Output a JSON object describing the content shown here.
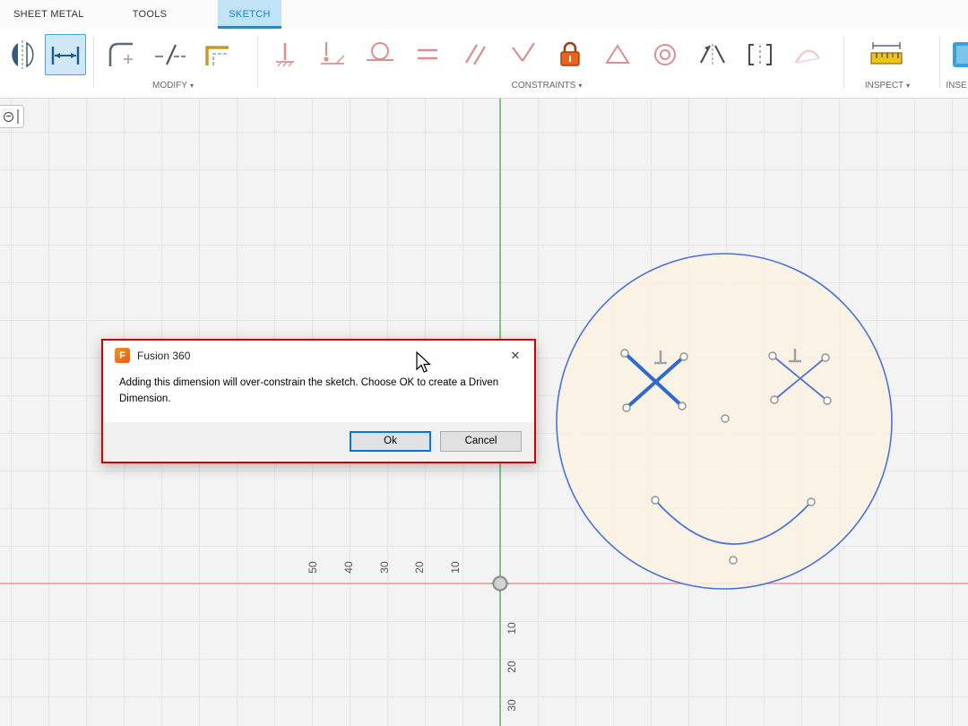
{
  "tabs": {
    "sheet_metal": "SHEET METAL",
    "tools": "TOOLS",
    "sketch": "SKETCH"
  },
  "toolbar": {
    "modify_label": "MODIFY",
    "constraints_label": "CONSTRAINTS",
    "inspect_label": "INSPECT",
    "insert_label": "INSE",
    "caret": "▾",
    "left_tools": [
      "mirror-tool",
      "sketch-dimension-tool"
    ],
    "selected_tool": "sketch-dimension-tool",
    "modify_tools": [
      "fillet-tool",
      "trim-tool",
      "offset-tool"
    ],
    "constraint_tools": [
      "horizontal-vertical",
      "coincident",
      "tangent",
      "equal",
      "parallel",
      "perpendicular",
      "fix-lock",
      "midpoint",
      "concentric",
      "symmetry",
      "collinear",
      "curvature"
    ],
    "inspect_tools": [
      "measure"
    ]
  },
  "dialog": {
    "title": "Fusion 360",
    "logo_letter": "F",
    "close": "✕",
    "message": "Adding this dimension will over-constrain the sketch. Choose OK to create a Driven Dimension.",
    "ok": "Ok",
    "cancel": "Cancel"
  },
  "rulers": {
    "horizontal": [
      "50",
      "40",
      "30",
      "20",
      "10"
    ],
    "vertical": [
      "10",
      "20",
      "30"
    ]
  },
  "colors": {
    "accent_blue": "#0696d7",
    "axis_green": "#5cb85c",
    "axis_red": "#ea9999",
    "sketch_blue": "#4a74d4",
    "selected_sketch_blue": "#2e6ad4",
    "face_fill": "#fbf1e1",
    "dialog_border": "#d40000",
    "ok_button_border": "#0078d7",
    "constraint_disabled": "#dd8f8f",
    "lock_orange": "#e8641b"
  }
}
